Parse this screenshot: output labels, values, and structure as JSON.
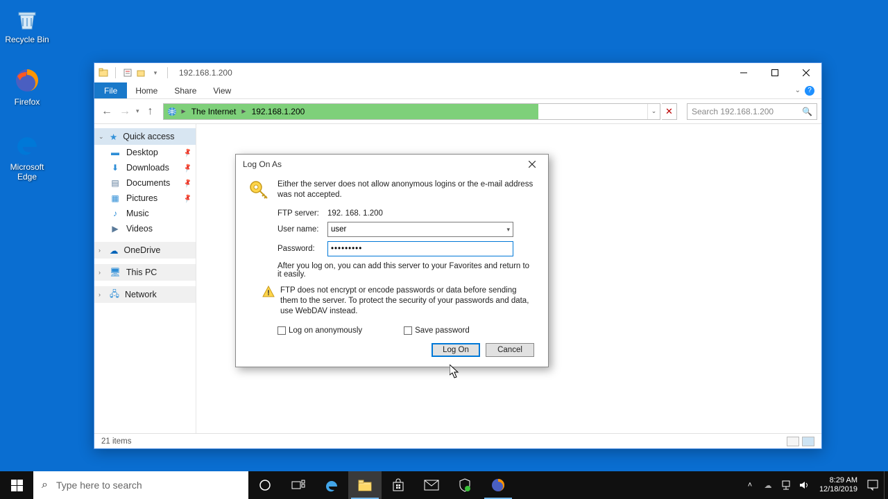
{
  "desktop_icons": {
    "recycle": "Recycle Bin",
    "firefox": "Firefox",
    "edge": "Microsoft Edge"
  },
  "explorer": {
    "title": "192.168.1.200",
    "tabs": {
      "file": "File",
      "home": "Home",
      "share": "Share",
      "view": "View"
    },
    "address": {
      "crumb1": "The Internet",
      "crumb2": "192.168.1.200"
    },
    "search_placeholder": "Search 192.168.1.200",
    "nav": {
      "quick": "Quick access",
      "desktop": "Desktop",
      "downloads": "Downloads",
      "documents": "Documents",
      "pictures": "Pictures",
      "music": "Music",
      "videos": "Videos",
      "onedrive": "OneDrive",
      "thispc": "This PC",
      "network": "Network"
    },
    "status": "21 items"
  },
  "dialog": {
    "title": "Log On As",
    "message": "Either the server does not allow anonymous logins or the e-mail address was not accepted.",
    "ftp_label": "FTP server:",
    "ftp_value": "192. 168. 1.200",
    "user_label": "User name:",
    "user_value": "user",
    "pass_label": "Password:",
    "pass_value": "•••••••••",
    "after_msg": "After you log on, you can add this server to your Favorites and return to it easily.",
    "warn_msg": "FTP does not encrypt or encode passwords or data before sending them to the server.  To protect the security of your passwords and data, use WebDAV instead.",
    "chk_anon": "Log on anonymously",
    "chk_save": "Save password",
    "btn_logon": "Log On",
    "btn_cancel": "Cancel"
  },
  "taskbar": {
    "search_placeholder": "Type here to search",
    "time": "8:29 AM",
    "date": "12/18/2019"
  }
}
